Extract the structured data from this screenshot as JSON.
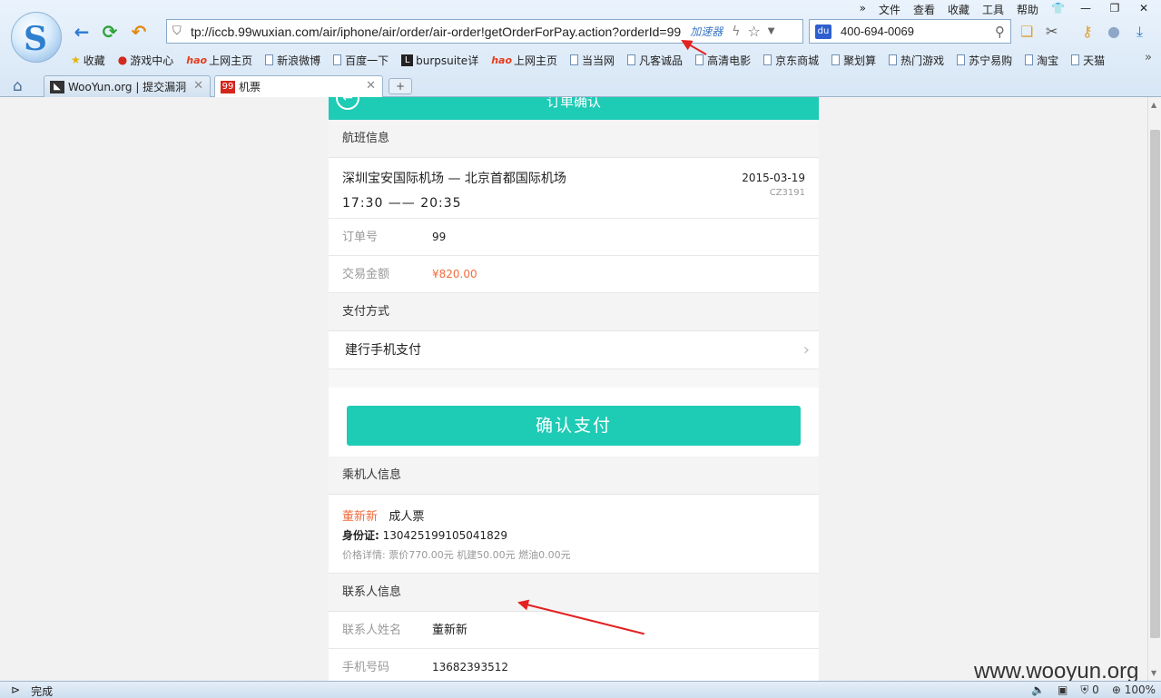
{
  "browser": {
    "menu": [
      "文件",
      "查看",
      "收藏",
      "工具",
      "帮助"
    ],
    "address": {
      "url": "tp://iccb.99wuxian.com/air/iphone/air/order/air-order!getOrderForPay.action?orderId=99",
      "accelerator": "加速器"
    },
    "search": {
      "value": "400-694-0069"
    },
    "bookmarks": [
      {
        "label": "收藏",
        "icon": "star-icon"
      },
      {
        "label": "游戏中心",
        "icon": "game-icon"
      },
      {
        "label": "上网主页",
        "icon": "hao-icon"
      },
      {
        "label": "新浪微博",
        "icon": "page-icon"
      },
      {
        "label": "百度一下",
        "icon": "page-icon"
      },
      {
        "label": "burpsuite详",
        "icon": "l-icon"
      },
      {
        "label": "上网主页",
        "icon": "hao-icon"
      },
      {
        "label": "当当网",
        "icon": "page-icon"
      },
      {
        "label": "凡客诚品",
        "icon": "page-icon"
      },
      {
        "label": "高清电影",
        "icon": "page-icon"
      },
      {
        "label": "京东商城",
        "icon": "page-icon"
      },
      {
        "label": "聚划算",
        "icon": "page-icon"
      },
      {
        "label": "热门游戏",
        "icon": "page-icon"
      },
      {
        "label": "苏宁易购",
        "icon": "page-icon"
      },
      {
        "label": "淘宝",
        "icon": "page-icon"
      },
      {
        "label": "天猫",
        "icon": "page-icon"
      }
    ],
    "tabs": [
      {
        "label": "WooYun.org | 提交漏洞",
        "active": false
      },
      {
        "label": "机票",
        "active": true,
        "favicon": "99"
      }
    ],
    "status": {
      "text": "完成",
      "count": "0",
      "zoom": "100%"
    }
  },
  "page": {
    "header_title": "订单确认",
    "flight_section": "航班信息",
    "route": "深圳宝安国际机场 — 北京首都国际机场",
    "times": "17:30 —— 20:35",
    "date": "2015-03-19",
    "flight_code": "CZ3191",
    "order_no_label": "订单号",
    "order_no": "99",
    "amount_label": "交易金额",
    "amount": "¥820.00",
    "pay_section": "支付方式",
    "pay_method": "建行手机支付",
    "confirm_button": "确认支付",
    "passenger_section": "乘机人信息",
    "passenger_name": "董新新",
    "ticket_type": "成人票",
    "id_label": "身份证:",
    "id_number": "130425199105041829",
    "price_detail": "价格详情:   票价770.00元  机建50.00元  燃油0.00元",
    "contact_section": "联系人信息",
    "contact_name_label": "联系人姓名",
    "contact_name": "董新新",
    "phone_label": "手机号码",
    "phone": "13682393512"
  },
  "watermark": "www.wooyun.org",
  "colors": {
    "accent": "#1ecbb5",
    "price": "#f26c3d",
    "annotation": "#e32121"
  }
}
